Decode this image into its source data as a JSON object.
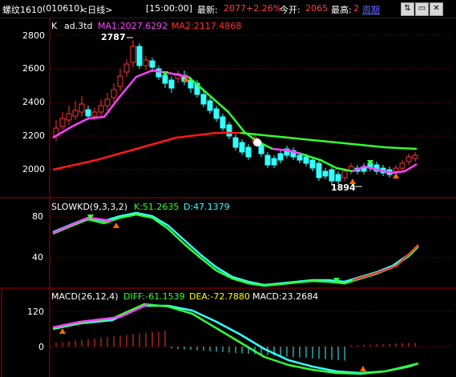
{
  "header": {
    "symbol": "螺纹1610",
    "code": "(010610)",
    "period": "<日线>",
    "time": "[15:00:00]",
    "latest_label": "最新:",
    "latest_value": "2077",
    "change": "+2.26%",
    "open_label": "今开:",
    "open_value": "2065",
    "high_label": "最高:",
    "high_value": "2",
    "period_link": "周期",
    "window_buttons": [
      "⇅",
      "▭",
      "✕"
    ]
  },
  "panel_main": {
    "title_k": "K",
    "title_name": "ad.3td",
    "ma1": "MA1:2027.6292",
    "ma2": "MA2:2117.4868",
    "high_marker": "2787",
    "low_marker": "1894",
    "y_ticks": [
      "2800",
      "2600",
      "2400",
      "2200",
      "2000"
    ]
  },
  "panel_kd": {
    "title": "SLOWKD(9,3,3,2)",
    "k": "K:51.2635",
    "d": "D:47.1379",
    "y_ticks": [
      "80",
      "40"
    ]
  },
  "panel_macd": {
    "title": "MACD(26,12,4)",
    "diff": "DIFF:-61.1539",
    "dea": "DEA:-72.7880",
    "macd": "MACD:23.2684",
    "y_ticks": [
      "120",
      "0"
    ]
  },
  "colors": {
    "up": "#ff3333",
    "down": "#33ffff",
    "ma1_up": "#ff40ff",
    "ma1_down": "#33ff33",
    "ma2": "#ff1a1a",
    "ma2_late": "#33ff33",
    "axis": "#aa0000",
    "text_yellow": "#ffff00",
    "text_red": "#ff4040",
    "text_white": "#ffffff",
    "text_blue": "#6666ff"
  }
}
